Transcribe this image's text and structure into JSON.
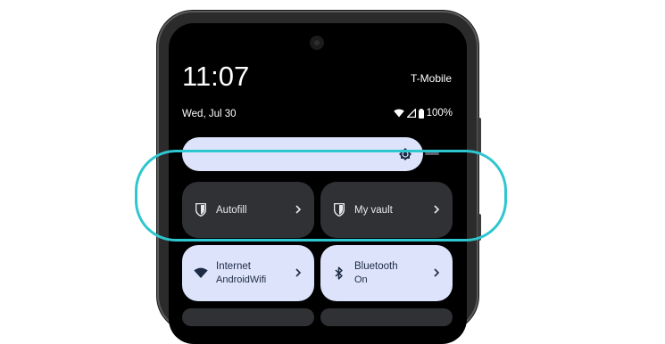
{
  "status_bar": {
    "time": "11:07",
    "carrier": "T-Mobile",
    "date": "Wed, Jul 30",
    "battery": "100%"
  },
  "brightness": {
    "icon": "brightness-icon"
  },
  "tiles": {
    "autofill": {
      "label": "Autofill",
      "icon": "bitwarden-shield-icon"
    },
    "vault": {
      "label": "My vault",
      "icon": "bitwarden-shield-icon"
    },
    "internet": {
      "label": "Internet",
      "sub": "AndroidWifi",
      "icon": "wifi-icon"
    },
    "bluetooth": {
      "label": "Bluetooth",
      "sub": "On",
      "icon": "bluetooth-icon"
    }
  },
  "colors": {
    "highlight": "#2ec6cf",
    "dark_tile": "#303135",
    "light_tile": "#dce3fb"
  }
}
